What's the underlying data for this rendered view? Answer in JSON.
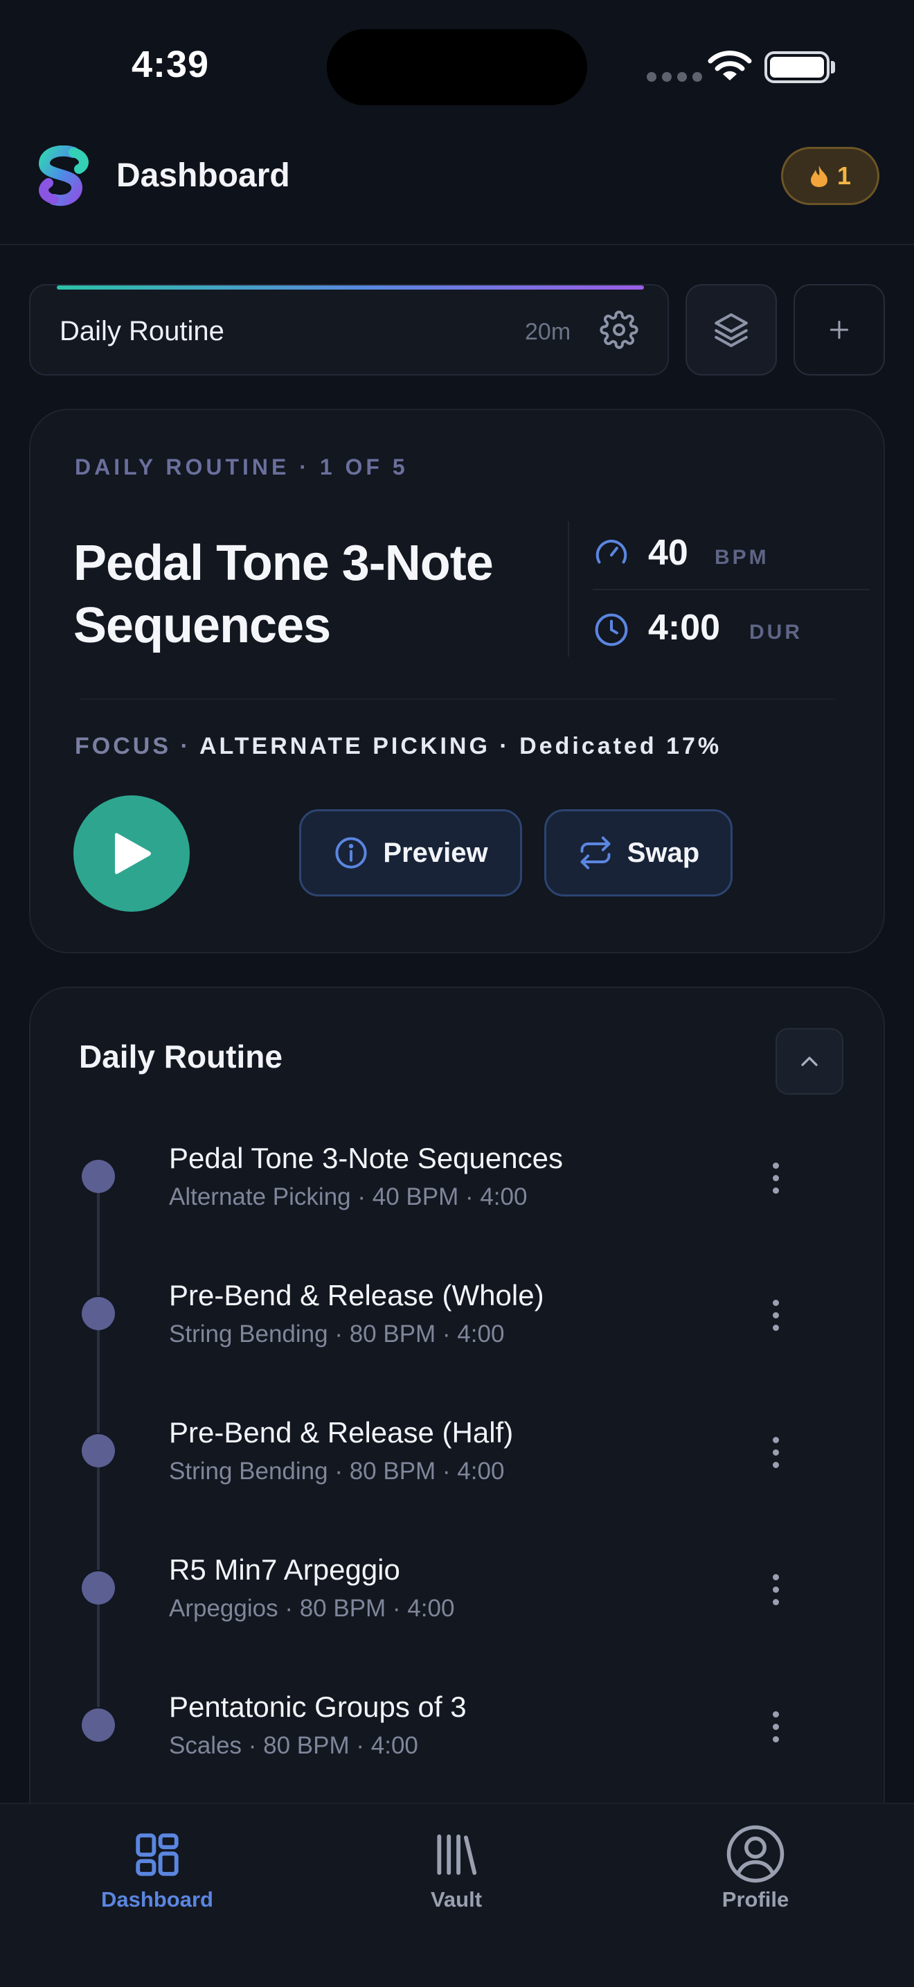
{
  "status_bar": {
    "time": "4:39"
  },
  "header": {
    "title": "Dashboard",
    "streak_count": "1",
    "streak_icon": "flame-icon"
  },
  "selector": {
    "routine_name": "Daily Routine",
    "duration": "20m"
  },
  "current": {
    "kicker": "DAILY ROUTINE · 1 OF 5",
    "title": "Pedal Tone 3-Note Sequences",
    "bpm_value": "40",
    "bpm_unit": "BPM",
    "duration_value": "4:00",
    "duration_unit": "DUR",
    "focus_prefix": "FOCUS · ",
    "focus_text": "ALTERNATE PICKING · Dedicated 17%",
    "preview_label": "Preview",
    "swap_label": "Swap"
  },
  "routine_list": {
    "title": "Daily Routine",
    "items": [
      {
        "name": "Pedal Tone 3-Note Sequences",
        "sub": "Alternate Picking · 40 BPM · 4:00"
      },
      {
        "name": "Pre-Bend & Release (Whole)",
        "sub": "String Bending · 80 BPM · 4:00"
      },
      {
        "name": "Pre-Bend & Release (Half)",
        "sub": "String Bending · 80 BPM · 4:00"
      },
      {
        "name": "R5 Min7 Arpeggio",
        "sub": "Arpeggios · 80 BPM · 4:00"
      },
      {
        "name": "Pentatonic Groups of 3",
        "sub": "Scales · 80 BPM · 4:00"
      }
    ]
  },
  "tabbar": {
    "tabs": [
      {
        "label": "Dashboard",
        "icon": "grid-icon",
        "active": true
      },
      {
        "label": "Vault",
        "icon": "library-icon",
        "active": false
      },
      {
        "label": "Profile",
        "icon": "user-circle-icon",
        "active": false
      }
    ]
  },
  "colors": {
    "background": "#0e121a",
    "accent": "#5b86e0",
    "teal": "#2ea68f",
    "streak": "#f3b544"
  }
}
